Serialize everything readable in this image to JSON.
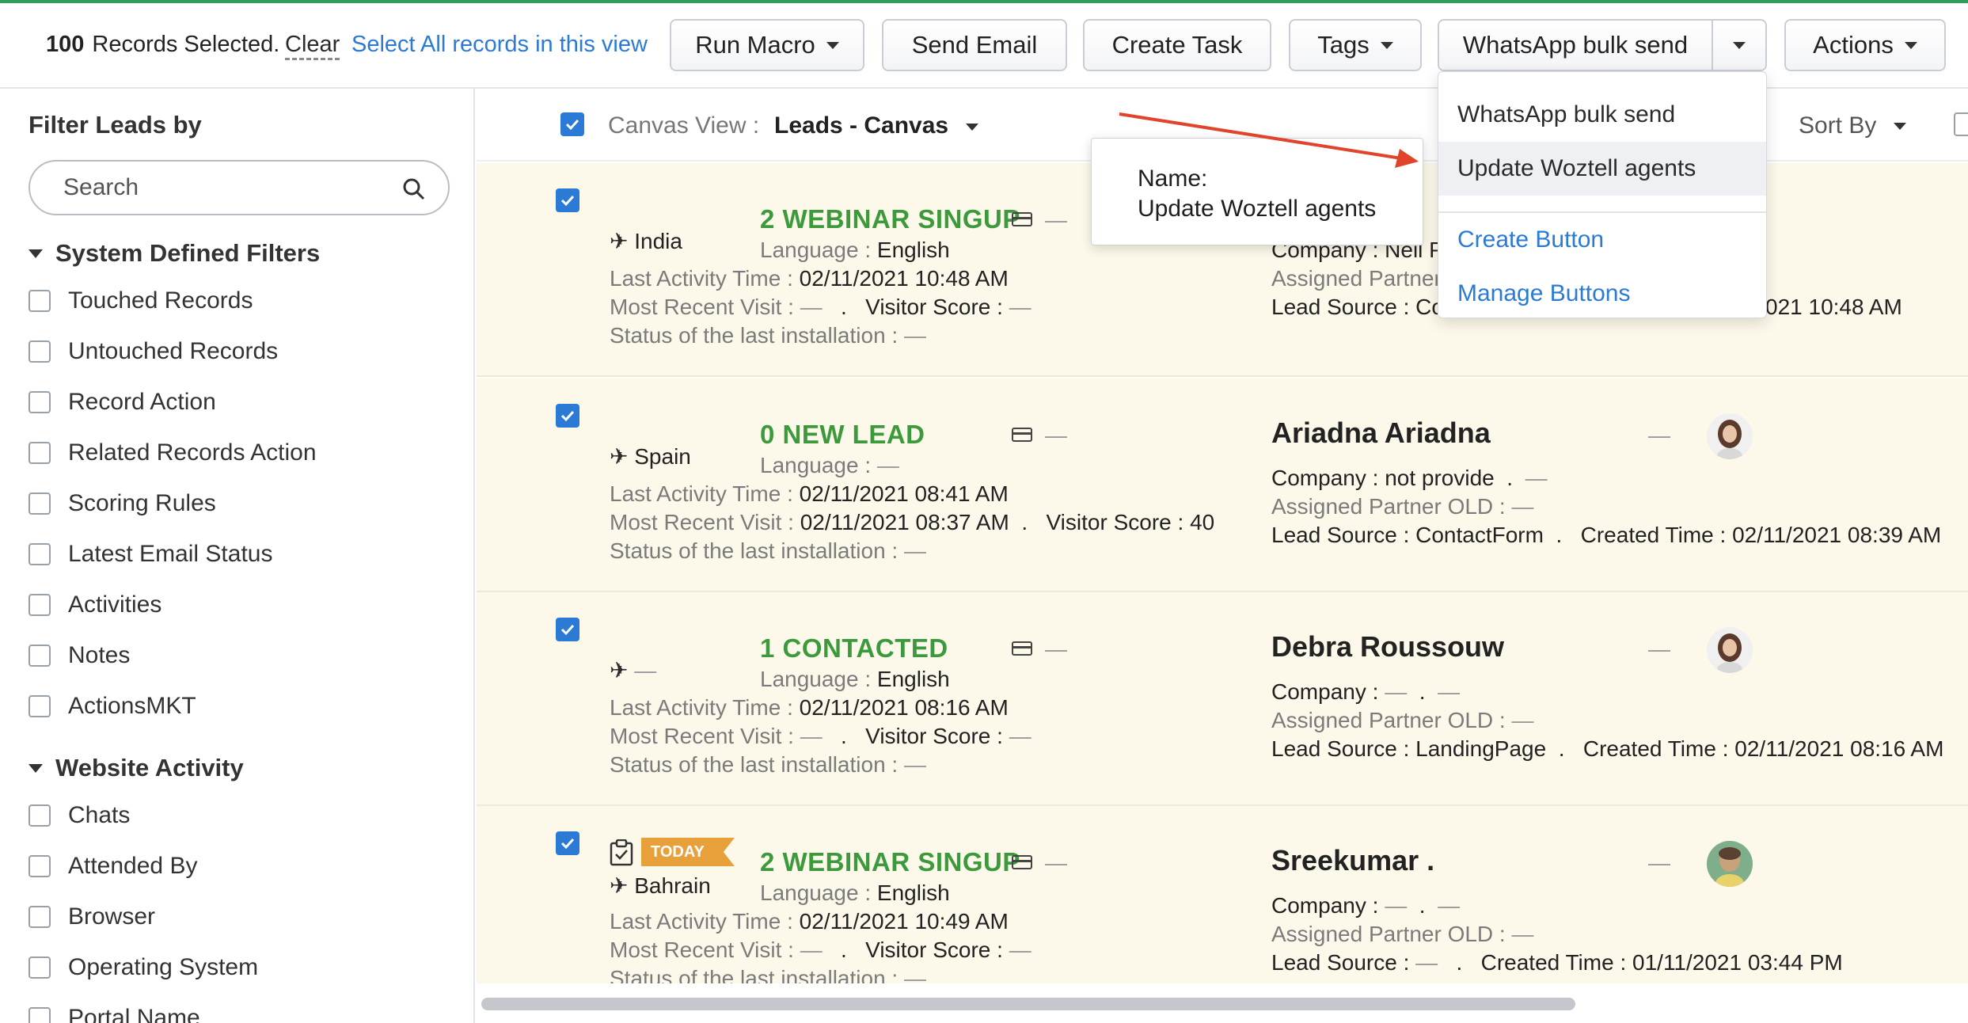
{
  "toolbar": {
    "selected_count": "100",
    "selected_text": "Records Selected.",
    "clear_label": "Clear",
    "select_all_label": "Select All records in this view",
    "run_macro_label": "Run Macro",
    "send_email_label": "Send Email",
    "create_task_label": "Create Task",
    "tags_label": "Tags",
    "whatsapp_label": "WhatsApp bulk send",
    "actions_label": "Actions"
  },
  "dropdown": {
    "items": [
      {
        "label": "WhatsApp bulk send"
      },
      {
        "label": "Update Woztell agents"
      },
      {
        "label": "Create Button"
      },
      {
        "label": "Manage Buttons"
      }
    ]
  },
  "tooltip": {
    "line1": "Name:",
    "line2": "Update Woztell agents"
  },
  "sidebar": {
    "title": "Filter Leads by",
    "search_placeholder": "Search",
    "system_section": "System Defined Filters",
    "system_items": [
      "Touched Records",
      "Untouched Records",
      "Record Action",
      "Related Records Action",
      "Scoring Rules",
      "Latest Email Status",
      "Activities",
      "Notes",
      "ActionsMKT"
    ],
    "website_section": "Website Activity",
    "website_items": [
      "Chats",
      "Attended By",
      "Browser",
      "Operating System",
      "Portal Name"
    ]
  },
  "canvas": {
    "view_label": "Canvas View :",
    "view_value": "Leads - Canvas",
    "sort_label": "Sort By"
  },
  "labels": {
    "language": "Language :",
    "last_activity": "Last Activity Time :",
    "most_recent_visit": "Most Recent Visit :",
    "visitor_score": "Visitor Score :",
    "status_install": "Status of the last installation :",
    "company": "Company :",
    "assigned_partner": "Assigned Partner OLD :",
    "lead_source": "Lead Source :",
    "created_time": "Created Time :",
    "dash": "—",
    "dot": "."
  },
  "cards": [
    {
      "country": "India",
      "stage": "2 WEBINAR SINGUP",
      "language": "English",
      "last_activity": "02/11/2021 10:48 AM",
      "most_recent_visit": "—",
      "visitor_score": "—",
      "status_install": "—",
      "company_partial": "Company : Neil Pa",
      "partner_partial": "Assigned Partner",
      "source_partial": "Lead Source : Con",
      "created_partial": "021 10:48 AM"
    },
    {
      "country": "Spain",
      "stage": "0 NEW LEAD",
      "language": "—",
      "last_activity": "02/11/2021 08:41 AM",
      "most_recent_visit": "02/11/2021 08:37 AM",
      "visitor_score": "40",
      "status_install": "—",
      "name": "Ariadna Ariadna",
      "company": "not provide",
      "partner": "—",
      "lead_source": "ContactForm",
      "created_time": "02/11/2021 08:39 AM"
    },
    {
      "country": "—",
      "stage": "1 CONTACTED",
      "language": "English",
      "last_activity": "02/11/2021 08:16 AM",
      "most_recent_visit": "—",
      "visitor_score": "—",
      "status_install": "—",
      "name": "Debra Roussouw",
      "company": "—",
      "partner": "—",
      "lead_source": "LandingPage",
      "created_time": "02/11/2021 08:16 AM"
    },
    {
      "badge": "TODAY",
      "country": "Bahrain",
      "stage": "2 WEBINAR SINGUP",
      "language": "English",
      "last_activity": "02/11/2021 10:49 AM",
      "most_recent_visit": "—",
      "visitor_score": "—",
      "status_install": "—",
      "name": "Sreekumar .",
      "company": "—",
      "partner": "—",
      "lead_source": "—",
      "created_time": "01/11/2021 03:44 PM"
    }
  ],
  "colors": {
    "accent_blue": "#2a7ad6",
    "stage_green": "#3c9a3c",
    "card_bg": "#fdf9ea",
    "today_badge": "#e8a13a",
    "annotation_arrow": "#e0442a"
  }
}
